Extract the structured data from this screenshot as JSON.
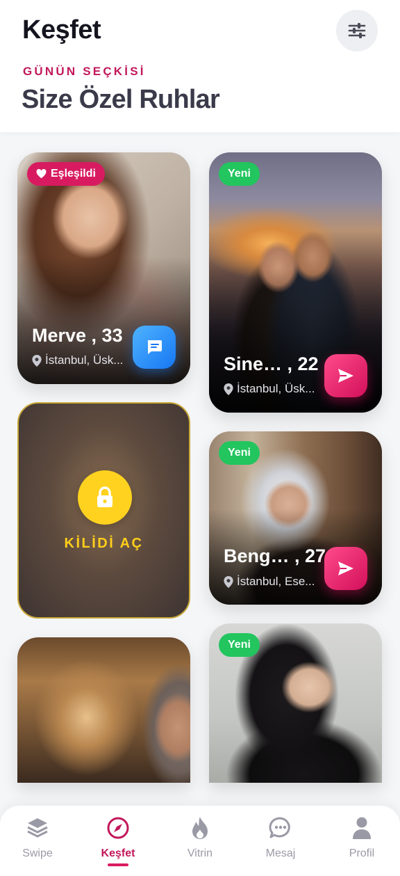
{
  "header": {
    "title": "Keşfet",
    "eyebrow": "GÜNÜN SEÇKİSİ",
    "subtitle": "Size Özel Ruhlar",
    "filter_icon": "sliders-icon"
  },
  "cards": [
    {
      "badge": "Eşleşildi",
      "badge_icon": "heart-icon",
      "name": "Merve , 33",
      "location": "İstanbul, Üsk...",
      "action_icon": "chat-icon"
    },
    {
      "badge": "Yeni",
      "name": "Sine…  , 22",
      "location": "İstanbul, Üsk...",
      "action_icon": "send-icon"
    },
    {
      "locked_label": "KİLİDİ AÇ",
      "lock_icon": "lock-icon"
    },
    {
      "badge": "Yeni",
      "name": "Beng… , 27",
      "location": "İstanbul, Ese...",
      "action_icon": "send-icon"
    },
    {},
    {
      "badge": "Yeni"
    }
  ],
  "nav": [
    {
      "label": "Swipe",
      "icon": "layers-icon",
      "active": false
    },
    {
      "label": "Keşfet",
      "icon": "compass-icon",
      "active": true
    },
    {
      "label": "Vitrin",
      "icon": "flame-icon",
      "active": false
    },
    {
      "label": "Mesaj",
      "icon": "chat-bubble-icon",
      "active": false
    },
    {
      "label": "Profil",
      "icon": "user-icon",
      "active": false
    }
  ],
  "colors": {
    "brand": "#c2185b",
    "new_badge": "#22c55e",
    "chat_button": "#1677f2",
    "unlock": "#ffd21f"
  }
}
